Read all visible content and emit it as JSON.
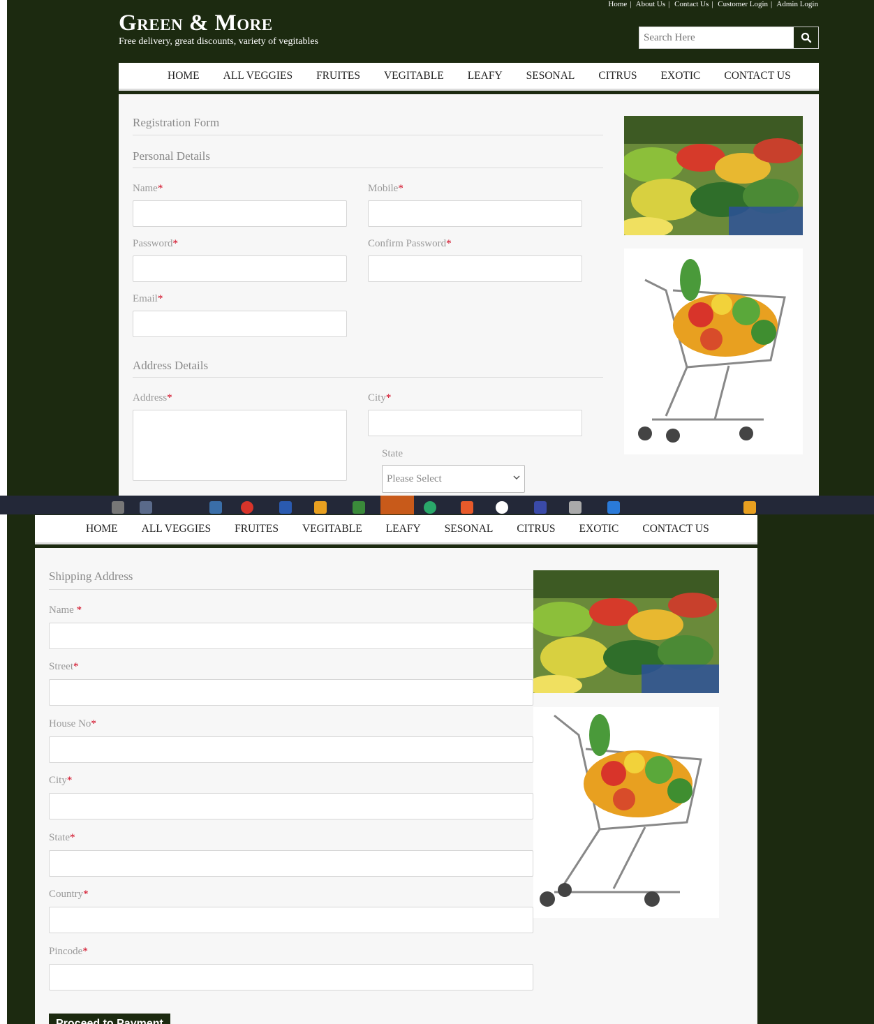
{
  "brand": {
    "title": "Green & More",
    "tagline": "Free delivery, great discounts, variety of vegitables"
  },
  "top_links": [
    "Home",
    "About Us",
    "Contact Us",
    "Customer Login",
    "Admin Login"
  ],
  "search": {
    "placeholder": "Search Here",
    "icon": "search-icon"
  },
  "nav": [
    "HOME",
    "ALL VEGGIES",
    "FRUITES",
    "VEGITABLE",
    "LEAFY",
    "SESONAL",
    "CITRUS",
    "EXOTIC",
    "CONTACT US"
  ],
  "registration": {
    "title": "Registration Form",
    "personal_title": "Personal Details",
    "labels": {
      "name": "Name",
      "mobile": "Mobile",
      "password": "Password",
      "confirm_password": "Confirm Password",
      "email": "Email"
    },
    "address_title": "Address Details",
    "address_labels": {
      "address": "Address",
      "city": "City",
      "state": "State"
    },
    "state_select": "Please Select",
    "required_mark": "*"
  },
  "shipping": {
    "title": "Shipping Address",
    "fields": [
      "Name",
      "Street",
      "House No",
      "City",
      "State",
      "Country",
      "Pincode"
    ],
    "required_mark": "*",
    "submit_label": "Proceed to Payment"
  },
  "colors": {
    "brand_dark": "#1c2a10",
    "required": "#d0021b",
    "panel_bg": "#f7f7f7"
  }
}
